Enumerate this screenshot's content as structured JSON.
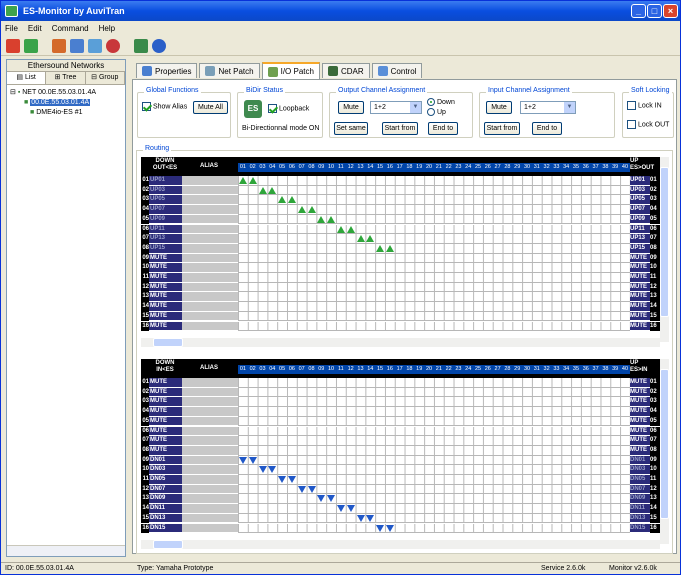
{
  "window": {
    "title": "ES-Monitor by AuviTran"
  },
  "menu": [
    "File",
    "Edit",
    "Command",
    "Help"
  ],
  "left_panel": {
    "header": "Ethersound Networks",
    "tabs": [
      "List",
      "Tree",
      "Group"
    ],
    "tree": {
      "net": "NET 00.0E.55.03.01.4A",
      "device_id": "00.0E.55.03.01.4A",
      "device_name": "DME4io-ES #1"
    }
  },
  "tabs": [
    "Properties",
    "Net Patch",
    "I/O Patch",
    "CDAR",
    "Control"
  ],
  "global_functions": {
    "label": "Global Functions",
    "show_alias": "Show Alias",
    "show_alias_checked": true,
    "mute_all": "Mute All"
  },
  "bidir_status": {
    "label": "BiDir Status",
    "logo": "ES",
    "loopback": "Loopback",
    "loopback_checked": true,
    "mode_text": "Bi-Directionnal mode ON"
  },
  "output_assign": {
    "label": "Output Channel Assignment",
    "mute": "Mute",
    "value": "1+2",
    "down": "Down",
    "up": "Up",
    "direction": "Down",
    "set_same": "Set same",
    "start_from": "Start from",
    "end_to": "End to"
  },
  "input_assign": {
    "label": "Input Channel Assignment",
    "mute": "Mute",
    "value": "1+2",
    "start_from": "Start from",
    "end_to": "End to"
  },
  "soft_locking": {
    "label": "Soft Locking",
    "lock_in": "Lock IN",
    "lock_out": "Lock OUT"
  },
  "routing": {
    "label": "Routing",
    "out_matrix": {
      "head_left": "DOWN\nOUT<ES",
      "head_alias": "ALIAS",
      "head_right": "UP\nES>OUT",
      "channels": [
        "01",
        "02",
        "03",
        "04",
        "05",
        "06",
        "07",
        "08",
        "09",
        "10",
        "11",
        "12",
        "13",
        "14",
        "15",
        "16",
        "17",
        "18",
        "19",
        "20",
        "21",
        "22",
        "23",
        "24",
        "25",
        "26",
        "27",
        "28",
        "29",
        "30",
        "31",
        "32",
        "33",
        "34",
        "35",
        "36",
        "37",
        "38",
        "39",
        "40"
      ],
      "left_names": [
        "UP01",
        "UP03",
        "UP05",
        "UP07",
        "UP09",
        "UP11",
        "UP13",
        "UP15",
        "MUTE",
        "MUTE",
        "MUTE",
        "MUTE",
        "MUTE",
        "MUTE",
        "MUTE",
        "MUTE"
      ],
      "right_names": [
        "UP01",
        "UP03",
        "UP05",
        "UP07",
        "UP09",
        "UP11",
        "UP13",
        "UP15",
        "MUTE",
        "MUTE",
        "MUTE",
        "MUTE",
        "MUTE",
        "MUTE",
        "MUTE",
        "MUTE"
      ]
    },
    "in_matrix": {
      "head_left": "DOWN\nIN<ES",
      "head_alias": "ALIAS",
      "head_right": "UP\nES>IN",
      "left_names": [
        "MUTE",
        "MUTE",
        "MUTE",
        "MUTE",
        "MUTE",
        "MUTE",
        "MUTE",
        "MUTE",
        "DN01",
        "DN03",
        "DN05",
        "DN07",
        "DN09",
        "DN11",
        "DN13",
        "DN15"
      ],
      "right_names": [
        "MUTE",
        "MUTE",
        "MUTE",
        "MUTE",
        "MUTE",
        "MUTE",
        "MUTE",
        "MUTE",
        "DN01",
        "DN03",
        "DN05",
        "DN07",
        "DN09",
        "DN11",
        "DN13",
        "DN15"
      ]
    }
  },
  "status": {
    "id": "ID: 00.0E.55.03.01.4A",
    "type": "Type: Yamaha Prototype",
    "service": "Service 2.6.0k",
    "monitor": "Monitor v2.6.0k"
  },
  "colors": {
    "accent": "#0044a8",
    "route_up": "#2ea53a",
    "route_down": "#2058c8"
  }
}
